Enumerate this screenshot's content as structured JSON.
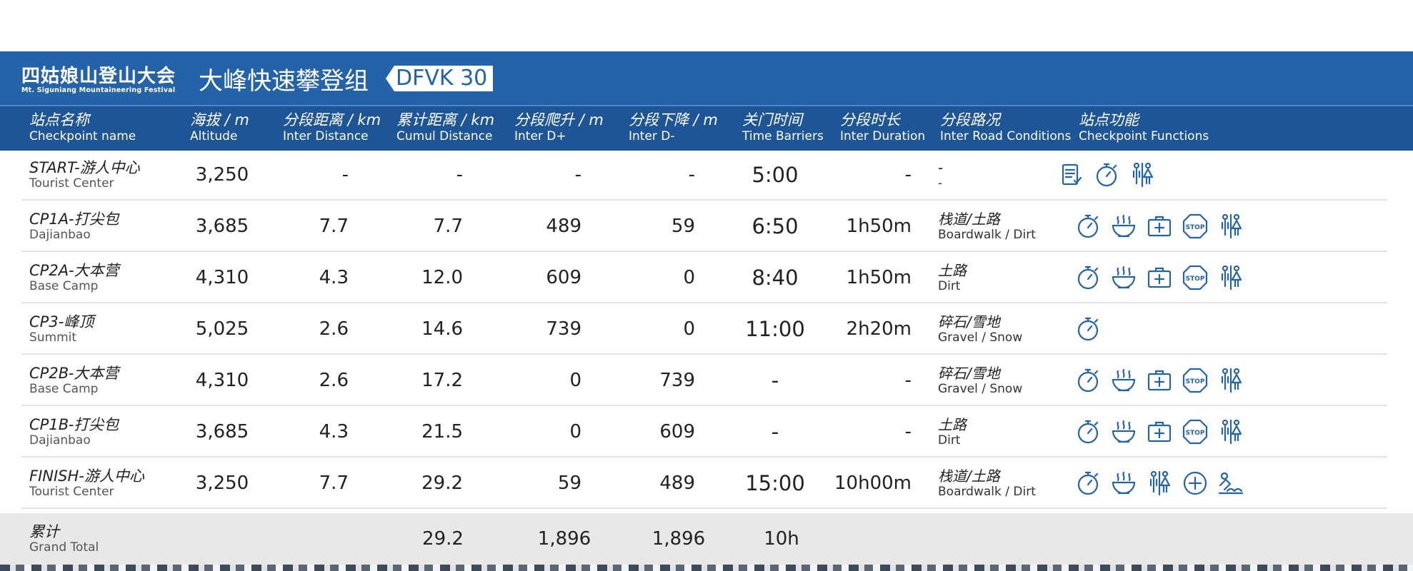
{
  "banner": {
    "event_name_cn": "四姑娘山登山大会",
    "event_name_en": "Mt. Siguniang Mountaineering Festival",
    "group_title": "大峰快速攀登组",
    "group_tag": "DFVK 30"
  },
  "columns": [
    {
      "cn": "站点名称",
      "en": "Checkpoint name"
    },
    {
      "cn": "海拔 / m",
      "en": "Altitude"
    },
    {
      "cn": "分段距离 / km",
      "en": "Inter Distance"
    },
    {
      "cn": "累计距离 / km",
      "en": "Cumul Distance"
    },
    {
      "cn": "分段爬升 / m",
      "en": "Inter D+"
    },
    {
      "cn": "分段下降 / m",
      "en": "Inter D-"
    },
    {
      "cn": "关门时间",
      "en": "Time Barriers"
    },
    {
      "cn": "分段时长",
      "en": "Inter Duration"
    },
    {
      "cn": "分段路况",
      "en": "Inter Road Conditions"
    },
    {
      "cn": "站点功能",
      "en": "Checkpoint Functions"
    }
  ],
  "rows": [
    {
      "name_cn": "START-游人中心",
      "name_en": "Tourist Center",
      "altitude": "3,250",
      "inter_dist": "-",
      "cumul_dist": "-",
      "d_plus": "-",
      "d_minus": "-",
      "barrier": "5:00",
      "duration": "-",
      "road_cn": "-",
      "road_en": "-",
      "functions": [
        "checklist-icon",
        "stopwatch-icon",
        "toilet-icon"
      ]
    },
    {
      "name_cn": "CP1A-打尖包",
      "name_en": "Dajianbao",
      "altitude": "3,685",
      "inter_dist": "7.7",
      "cumul_dist": "7.7",
      "d_plus": "489",
      "d_minus": "59",
      "barrier": "6:50",
      "duration": "1h50m",
      "road_cn": "栈道/土路",
      "road_en": "Boardwalk / Dirt",
      "functions": [
        "stopwatch-icon",
        "food-bowl-icon",
        "first-aid-icon",
        "stop-sign-icon",
        "toilet-icon"
      ]
    },
    {
      "name_cn": "CP2A-大本营",
      "name_en": "Base Camp",
      "altitude": "4,310",
      "inter_dist": "4.3",
      "cumul_dist": "12.0",
      "d_plus": "609",
      "d_minus": "0",
      "barrier": "8:40",
      "duration": "1h50m",
      "road_cn": "土路",
      "road_en": "Dirt",
      "functions": [
        "stopwatch-icon",
        "food-bowl-icon",
        "first-aid-icon",
        "stop-sign-icon",
        "toilet-icon"
      ]
    },
    {
      "name_cn": "CP3-峰顶",
      "name_en": "Summit",
      "altitude": "5,025",
      "inter_dist": "2.6",
      "cumul_dist": "14.6",
      "d_plus": "739",
      "d_minus": "0",
      "barrier": "11:00",
      "duration": "2h20m",
      "road_cn": "碎石/雪地",
      "road_en": "Gravel / Snow",
      "functions": [
        "stopwatch-icon"
      ]
    },
    {
      "name_cn": "CP2B-大本营",
      "name_en": "Base Camp",
      "altitude": "4,310",
      "inter_dist": "2.6",
      "cumul_dist": "17.2",
      "d_plus": "0",
      "d_minus": "739",
      "barrier": "-",
      "duration": "-",
      "road_cn": "碎石/雪地",
      "road_en": "Gravel / Snow",
      "functions": [
        "stopwatch-icon",
        "food-bowl-icon",
        "first-aid-icon",
        "stop-sign-icon",
        "toilet-icon"
      ]
    },
    {
      "name_cn": "CP1B-打尖包",
      "name_en": "Dajianbao",
      "altitude": "3,685",
      "inter_dist": "4.3",
      "cumul_dist": "21.5",
      "d_plus": "0",
      "d_minus": "609",
      "barrier": "-",
      "duration": "-",
      "road_cn": "土路",
      "road_en": "Dirt",
      "functions": [
        "stopwatch-icon",
        "food-bowl-icon",
        "first-aid-icon",
        "stop-sign-icon",
        "toilet-icon"
      ]
    },
    {
      "name_cn": "FINISH-游人中心",
      "name_en": "Tourist Center",
      "altitude": "3,250",
      "inter_dist": "7.7",
      "cumul_dist": "29.2",
      "d_plus": "59",
      "d_minus": "489",
      "barrier": "15:00",
      "duration": "10h00m",
      "road_cn": "栈道/土路",
      "road_en": "Boardwalk / Dirt",
      "functions": [
        "stopwatch-icon",
        "food-bowl-icon",
        "toilet-icon",
        "medical-cross-icon",
        "shower-icon"
      ]
    }
  ],
  "total": {
    "name_cn": "累计",
    "name_en": "Grand Total",
    "cumul_dist": "29.2",
    "d_plus": "1,896",
    "d_minus": "1,896",
    "barrier": "10h"
  },
  "stop_icon_text": "STOP",
  "colors": {
    "banner": "#2563a8",
    "header": "#1e5596",
    "icon": "#2563a8",
    "total_row": "#e8e8e8"
  }
}
